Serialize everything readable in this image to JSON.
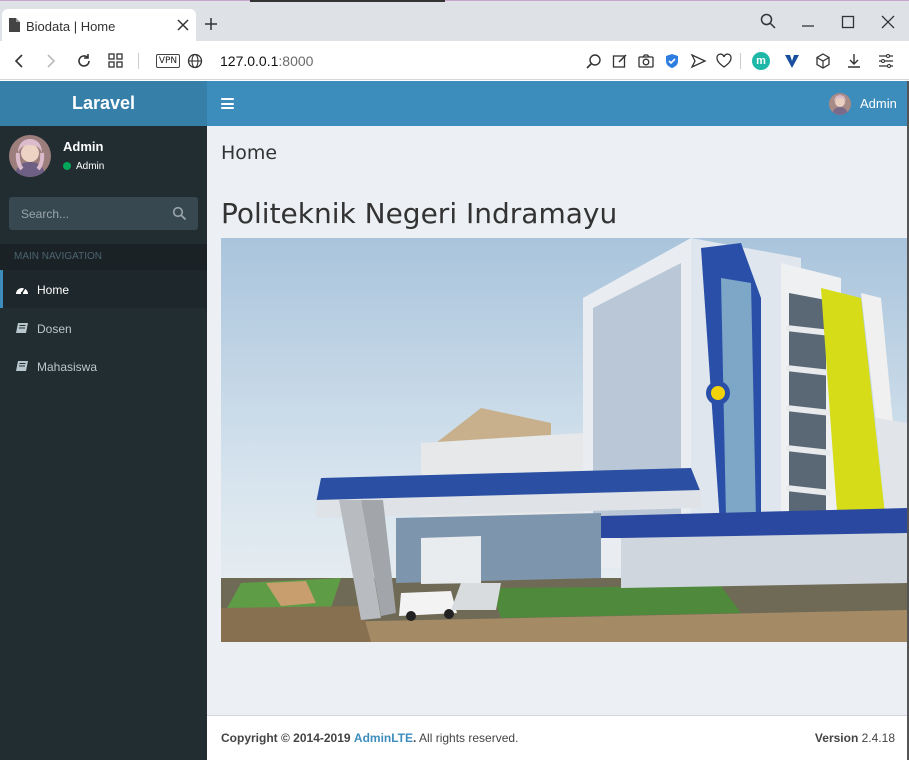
{
  "browser": {
    "tab_title": "Biodata | Home",
    "url_host": "127.0.0.1",
    "url_port": ":8000",
    "vpn_label": "VPN",
    "extension_badge": "m"
  },
  "app": {
    "logo": "Laravel",
    "top_user": "Admin"
  },
  "sidebar": {
    "user_name": "Admin",
    "user_status": "Admin",
    "status_color": "#00a65a",
    "search_placeholder": "Search...",
    "nav_header": "MAIN NAVIGATION",
    "items": [
      {
        "label": "Home",
        "icon": "dashboard-icon",
        "active": true
      },
      {
        "label": "Dosen",
        "icon": "book-icon",
        "active": false
      },
      {
        "label": "Mahasiswa",
        "icon": "book-icon",
        "active": false
      }
    ]
  },
  "content": {
    "page_header": "Home",
    "title": "Politeknik Negeri Indramayu"
  },
  "footer": {
    "copyright_prefix": "Copyright © 2014-2019",
    "copyright_link": "AdminLTE",
    "copyright_suffix": ". All rights reserved.",
    "version_label": "Version",
    "version": "2.4.18"
  },
  "colors": {
    "header": "#3c8dbc",
    "logo_bg": "#367fa9",
    "sidebar_bg": "#222d32",
    "content_bg": "#ecf0f5"
  }
}
